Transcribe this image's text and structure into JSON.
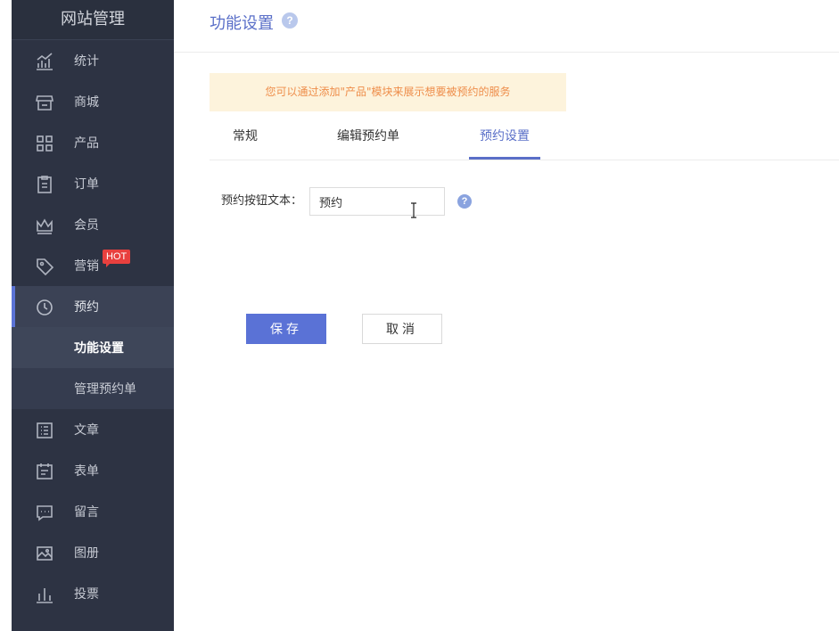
{
  "sidebar": {
    "title": "网站管理",
    "items": [
      {
        "label": "统计",
        "icon": "stats-icon"
      },
      {
        "label": "商城",
        "icon": "shop-icon"
      },
      {
        "label": "产品",
        "icon": "product-icon"
      },
      {
        "label": "订单",
        "icon": "order-icon"
      },
      {
        "label": "会员",
        "icon": "crown-icon"
      },
      {
        "label": "营销",
        "icon": "tag-icon",
        "badge": "HOT"
      },
      {
        "label": "预约",
        "icon": "clock-icon",
        "active": true
      },
      {
        "label": "文章",
        "icon": "article-icon"
      },
      {
        "label": "表单",
        "icon": "form-icon"
      },
      {
        "label": "留言",
        "icon": "message-icon"
      },
      {
        "label": "图册",
        "icon": "gallery-icon"
      },
      {
        "label": "投票",
        "icon": "vote-icon"
      }
    ],
    "sub_items": [
      {
        "label": "功能设置",
        "current": true
      },
      {
        "label": "管理预约单"
      }
    ]
  },
  "header": {
    "title": "功能设置",
    "help_icon": "?"
  },
  "notice": "您可以通过添加\"产品\"模块来展示想要被预约的服务",
  "tabs": [
    {
      "label": "常规"
    },
    {
      "label": "编辑预约单"
    },
    {
      "label": "预约设置",
      "active": true
    }
  ],
  "form": {
    "label": "预约按钮文本：",
    "value": "预约",
    "help_icon": "?"
  },
  "buttons": {
    "save": "保存",
    "cancel": "取消"
  },
  "colors": {
    "sidebar_bg": "#2d3343",
    "accent": "#5a72d6",
    "notice_bg": "#fdf3dc",
    "notice_text": "#ee8d4a",
    "hot_badge": "#e8403e"
  }
}
